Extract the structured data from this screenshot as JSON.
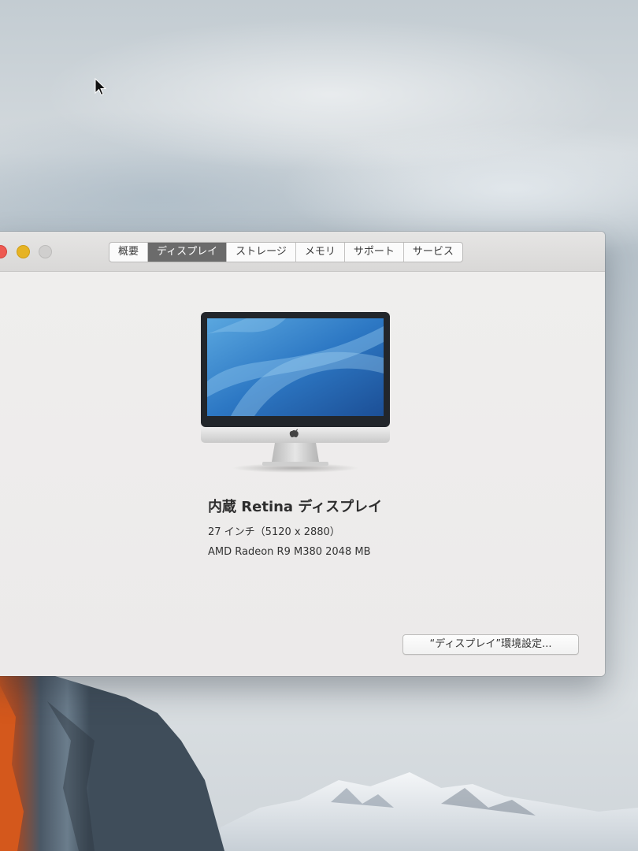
{
  "window": {
    "tabs": [
      {
        "label": "概要"
      },
      {
        "label": "ディスプレイ"
      },
      {
        "label": "ストレージ"
      },
      {
        "label": "メモリ"
      },
      {
        "label": "サポート"
      },
      {
        "label": "サービス"
      }
    ],
    "active_tab_index": 1
  },
  "display": {
    "name": "内蔵 Retina ディスプレイ",
    "size": "27 インチ（5120 x 2880）",
    "graphics": "AMD Radeon R9 M380 2048 MB"
  },
  "buttons": {
    "display_prefs_label": "“ディスプレイ”環境設定..."
  },
  "colors": {
    "close": "#ee5a52",
    "minimize": "#e6b324",
    "zoom_inactive": "#d0cfce",
    "active_tab": "#6b6b6b"
  },
  "icons": {
    "cursor": "arrow-cursor-icon",
    "device": "imac-icon",
    "logo": "apple-logo-icon"
  }
}
